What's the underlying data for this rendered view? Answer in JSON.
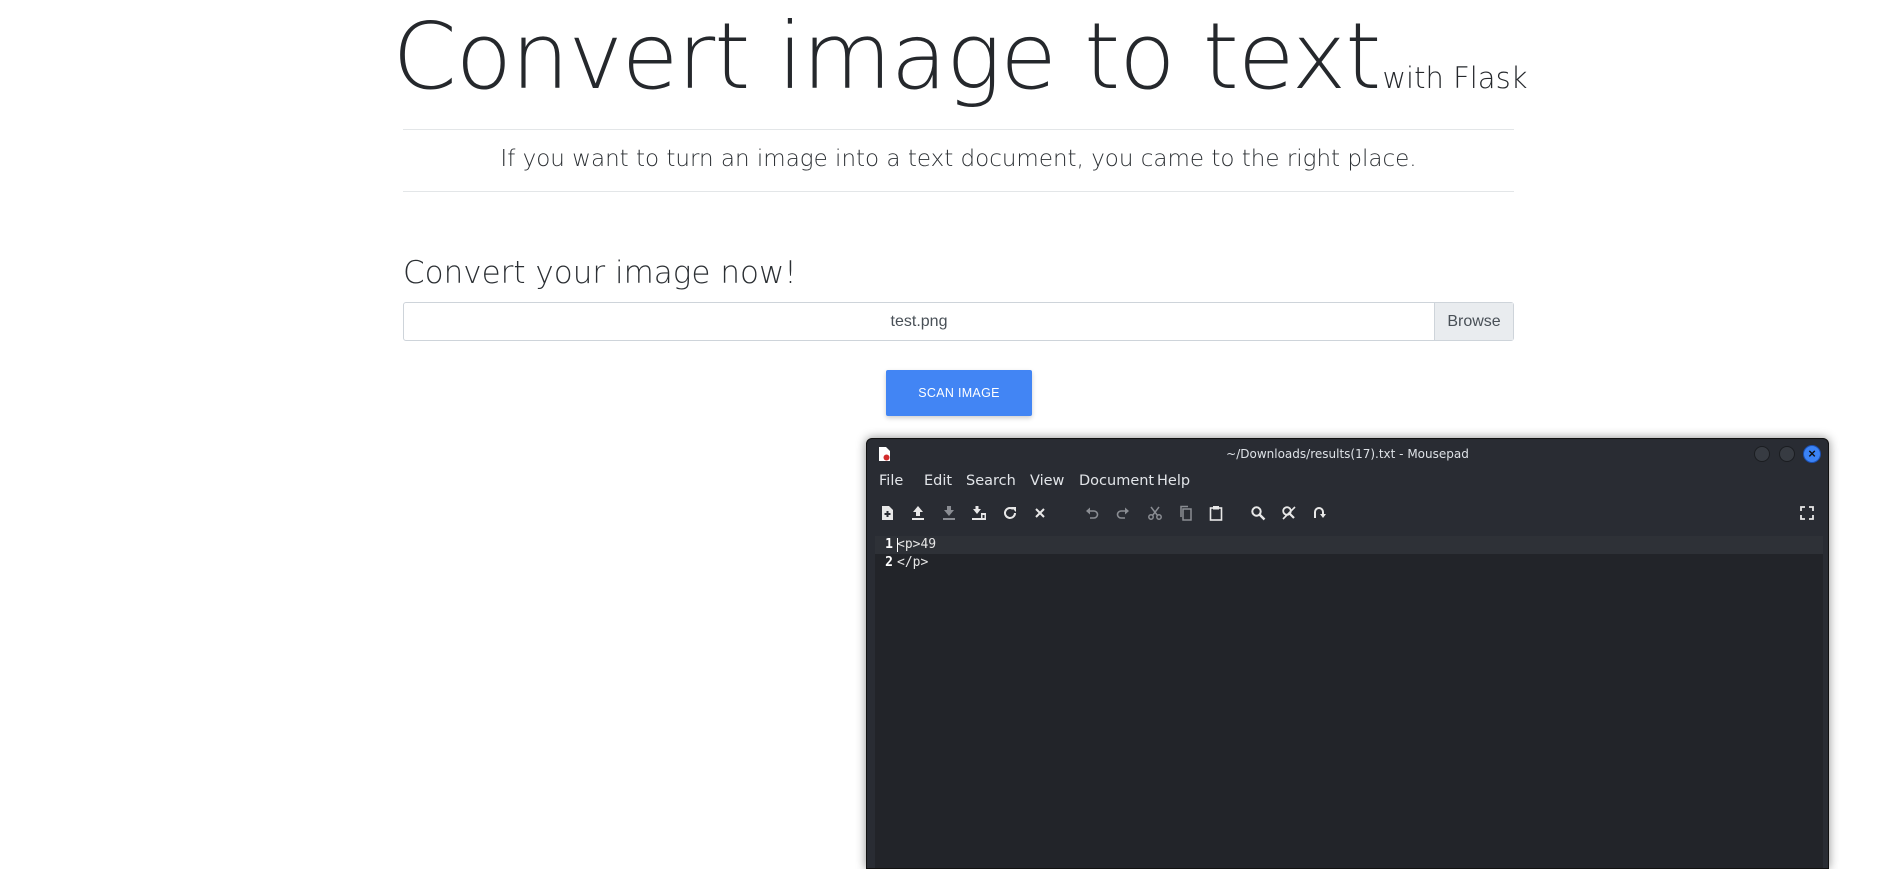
{
  "page": {
    "title": "Convert image to text",
    "title_suffix": "with Flask",
    "tagline": "If you want to turn an image into a text document, you came to the right place.",
    "section_title": "Convert your image now!",
    "file_input": {
      "filename": "test.png",
      "browse_label": "Browse"
    },
    "scan_button": "SCAN IMAGE"
  },
  "editor_window": {
    "title": "~/Downloads/results(17).txt - Mousepad",
    "menu": [
      "File",
      "Edit",
      "Search",
      "View",
      "Document",
      "Help"
    ],
    "toolbar_icons": [
      "new-document-icon",
      "open-icon",
      "save-icon",
      "save-as-icon",
      "reload-icon",
      "close-document-icon",
      "undo-icon",
      "redo-icon",
      "cut-icon",
      "copy-icon",
      "paste-icon",
      "find-icon",
      "find-replace-icon",
      "go-to-line-icon",
      "fullscreen-icon"
    ],
    "lines": [
      {
        "number": "1",
        "text": "<p>49"
      },
      {
        "number": "2",
        "text": "</p>"
      }
    ],
    "accent_color": "#3b83f6"
  }
}
